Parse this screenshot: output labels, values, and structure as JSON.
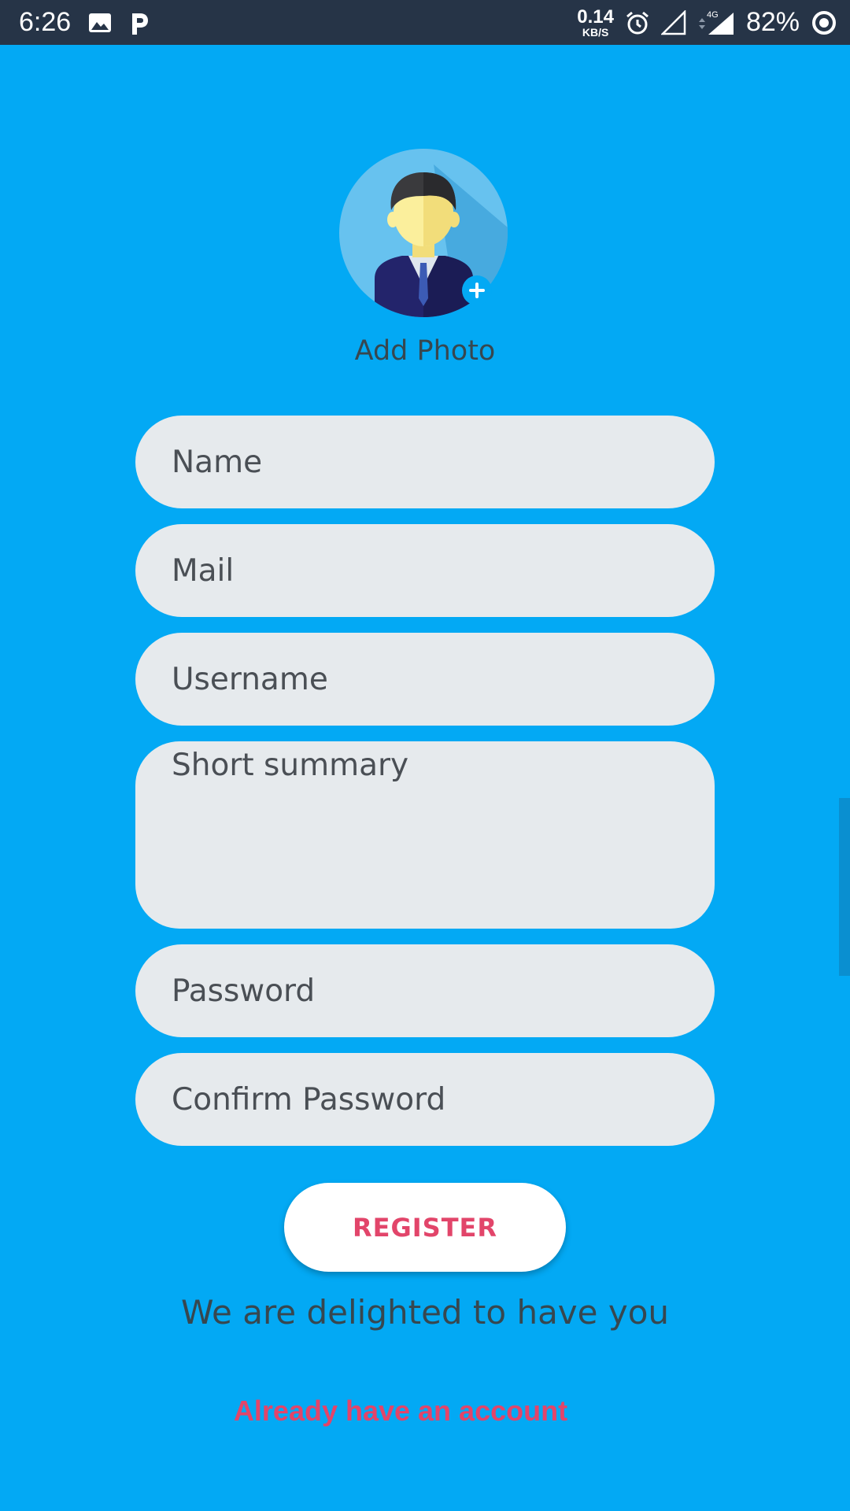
{
  "status_bar": {
    "time": "6:26",
    "net_speed_value": "0.14",
    "net_speed_unit": "KB/S",
    "network_type": "4G",
    "battery": "82%",
    "icons": [
      "image-icon",
      "p-app-icon",
      "alarm-icon",
      "signal-icon",
      "signal-4g-icon",
      "battery-ring-icon"
    ]
  },
  "profile": {
    "add_photo_label": "Add Photo"
  },
  "form": {
    "name_placeholder": "Name",
    "mail_placeholder": "Mail",
    "username_placeholder": "Username",
    "summary_placeholder": "Short summary",
    "password_placeholder": "Password",
    "confirm_password_placeholder": "Confirm Password"
  },
  "actions": {
    "register_label": "REGISTER",
    "tagline": "We are delighted to have you",
    "login_link": "Already have an account"
  },
  "colors": {
    "background": "#03a9f4",
    "status_bar": "#263447",
    "field": "#e6eaed",
    "accent": "#e2456a"
  }
}
